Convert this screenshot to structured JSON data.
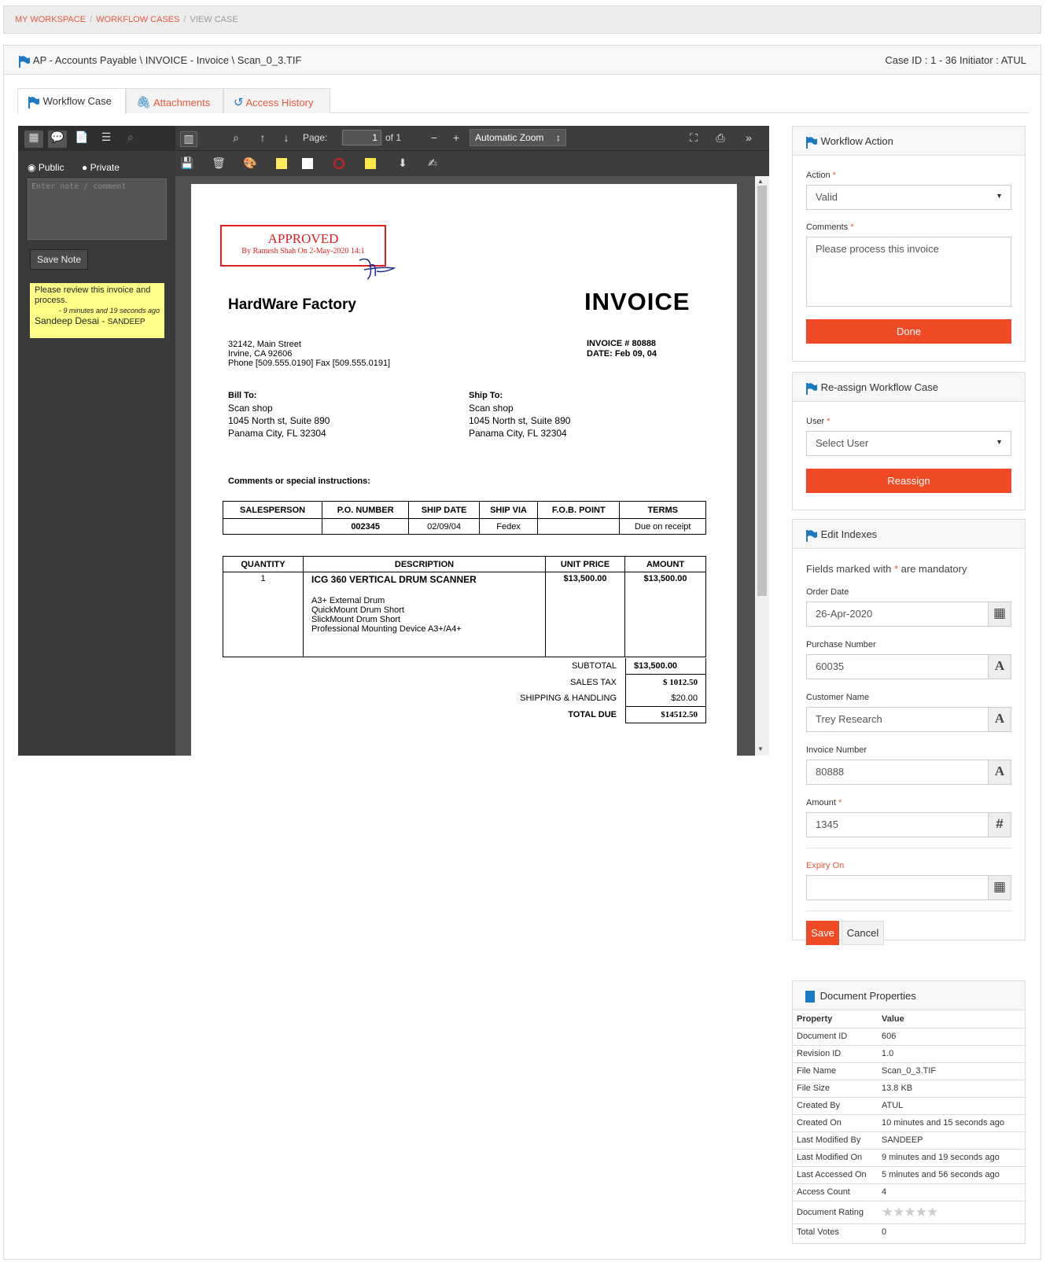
{
  "breadcrumb": {
    "item1": "MY WORKSPACE",
    "item2": "WORKFLOW CASES",
    "item3": "VIEW CASE"
  },
  "titlebar": {
    "path": "AP - Accounts Payable \\ INVOICE - Invoice \\ Scan_0_3.TIF",
    "case_info": "Case ID : 1 - 36 Initiator : ATUL"
  },
  "tabs": {
    "workflow": "Workflow Case",
    "attachments": "Attachments",
    "history": "Access History"
  },
  "viewer": {
    "page_label": "Page:",
    "page_value": "1",
    "page_total": "of 1",
    "zoom": "Automatic Zoom",
    "radio_public": "Public",
    "radio_private": "Private",
    "note_placeholder": "Enter note / comment",
    "save_note": "Save Note",
    "sticky": {
      "text": "Please review this invoice and process.",
      "time": "- 9 minutes and 19 seconds ago",
      "author": "Sandeep Desai - ",
      "author_id": "SANDEEP"
    }
  },
  "invoice": {
    "stamp_title": "APPROVED",
    "stamp_sub": "By Ramesh Shah On 2-May-2020 14:1",
    "company": "HardWare Factory",
    "heading": "INVOICE",
    "addr1": "32142, Main Street",
    "addr2": "Irvine, CA 92606",
    "phone": "Phone [509.555.0190]  Fax [509.555.0191]",
    "invno": "INVOICE # 80888",
    "date": "DATE: Feb 09, 04",
    "billto": "Bill To:",
    "shipto": "Ship To:",
    "cust1": "Scan shop",
    "cust2": "1045 North st, Suite 890",
    "cust3": "Panama City, FL 32304",
    "comments": "Comments or special instructions:",
    "t1": {
      "h": [
        "SALESPERSON",
        "P.O. NUMBER",
        "SHIP DATE",
        "SHIP VIA",
        "F.O.B. POINT",
        "TERMS"
      ],
      "r": [
        "",
        "002345",
        "02/09/04",
        "Fedex",
        "",
        "Due on receipt"
      ]
    },
    "t2": {
      "h": [
        "QUANTITY",
        "DESCRIPTION",
        "UNIT PRICE",
        "AMOUNT"
      ],
      "qty": "1",
      "item": "ICG 360 VERTICAL DRUM SCANNER",
      "sub1": "A3+ External Drum",
      "sub2": "QuickMount Drum Short",
      "sub3": "SlickMount Drum Short",
      "sub4": "Professional Mounting Device A3+/A4+",
      "price": "$13,500.00",
      "amount": "$13,500.00"
    },
    "totals": {
      "subtotal_l": "SUBTOTAL",
      "subtotal": "$13,500.00",
      "tax_l": "SALES TAX",
      "tax": "$ 1012.50",
      "ship_l": "SHIPPING & HANDLING",
      "ship": "$20.00",
      "due_l": "TOTAL DUE",
      "due": "$14512.50"
    }
  },
  "workflow_action": {
    "title": "Workflow Action",
    "action_label": "Action",
    "action_value": "Valid",
    "comments_label": "Comments",
    "comments_value": "Please process this invoice",
    "done": "Done"
  },
  "reassign": {
    "title": "Re-assign Workflow Case",
    "user_label": "User",
    "user_value": "Select User",
    "button": "Reassign"
  },
  "indexes": {
    "title": "Edit Indexes",
    "note_pre": "Fields marked with ",
    "note_post": " are mandatory",
    "order_date_label": "Order Date",
    "order_date": "26-Apr-2020",
    "purchase_label": "Purchase Number",
    "purchase": "60035",
    "customer_label": "Customer Name",
    "customer": "Trey Research",
    "invoice_label": "Invoice Number",
    "invoice": "80888",
    "amount_label": "Amount",
    "amount": "1345",
    "expiry_label": "Expiry On",
    "expiry": "",
    "save": "Save",
    "cancel": "Cancel"
  },
  "doc_props": {
    "title": "Document Properties",
    "h_prop": "Property",
    "h_val": "Value",
    "rows": [
      [
        "Document ID",
        "606"
      ],
      [
        "Revision ID",
        "1.0"
      ],
      [
        "File Name",
        "Scan_0_3.TIF"
      ],
      [
        "File Size",
        "13.8 KB"
      ],
      [
        "Created By",
        "ATUL"
      ],
      [
        "Created On",
        "10 minutes and 15 seconds ago"
      ],
      [
        "Last Modified By",
        "SANDEEP"
      ],
      [
        "Last Modified On",
        "9 minutes and 19 seconds ago"
      ],
      [
        "Last Accessed On",
        "5 minutes and 56 seconds ago"
      ],
      [
        "Access Count",
        "4"
      ],
      [
        "Document Rating",
        ""
      ],
      [
        "Total Votes",
        "0"
      ]
    ],
    "rating": 0,
    "rating_max": 5
  },
  "colors": {
    "accent": "#e55a3c",
    "button": "#f04a26",
    "flag": "#1a7bc4"
  }
}
